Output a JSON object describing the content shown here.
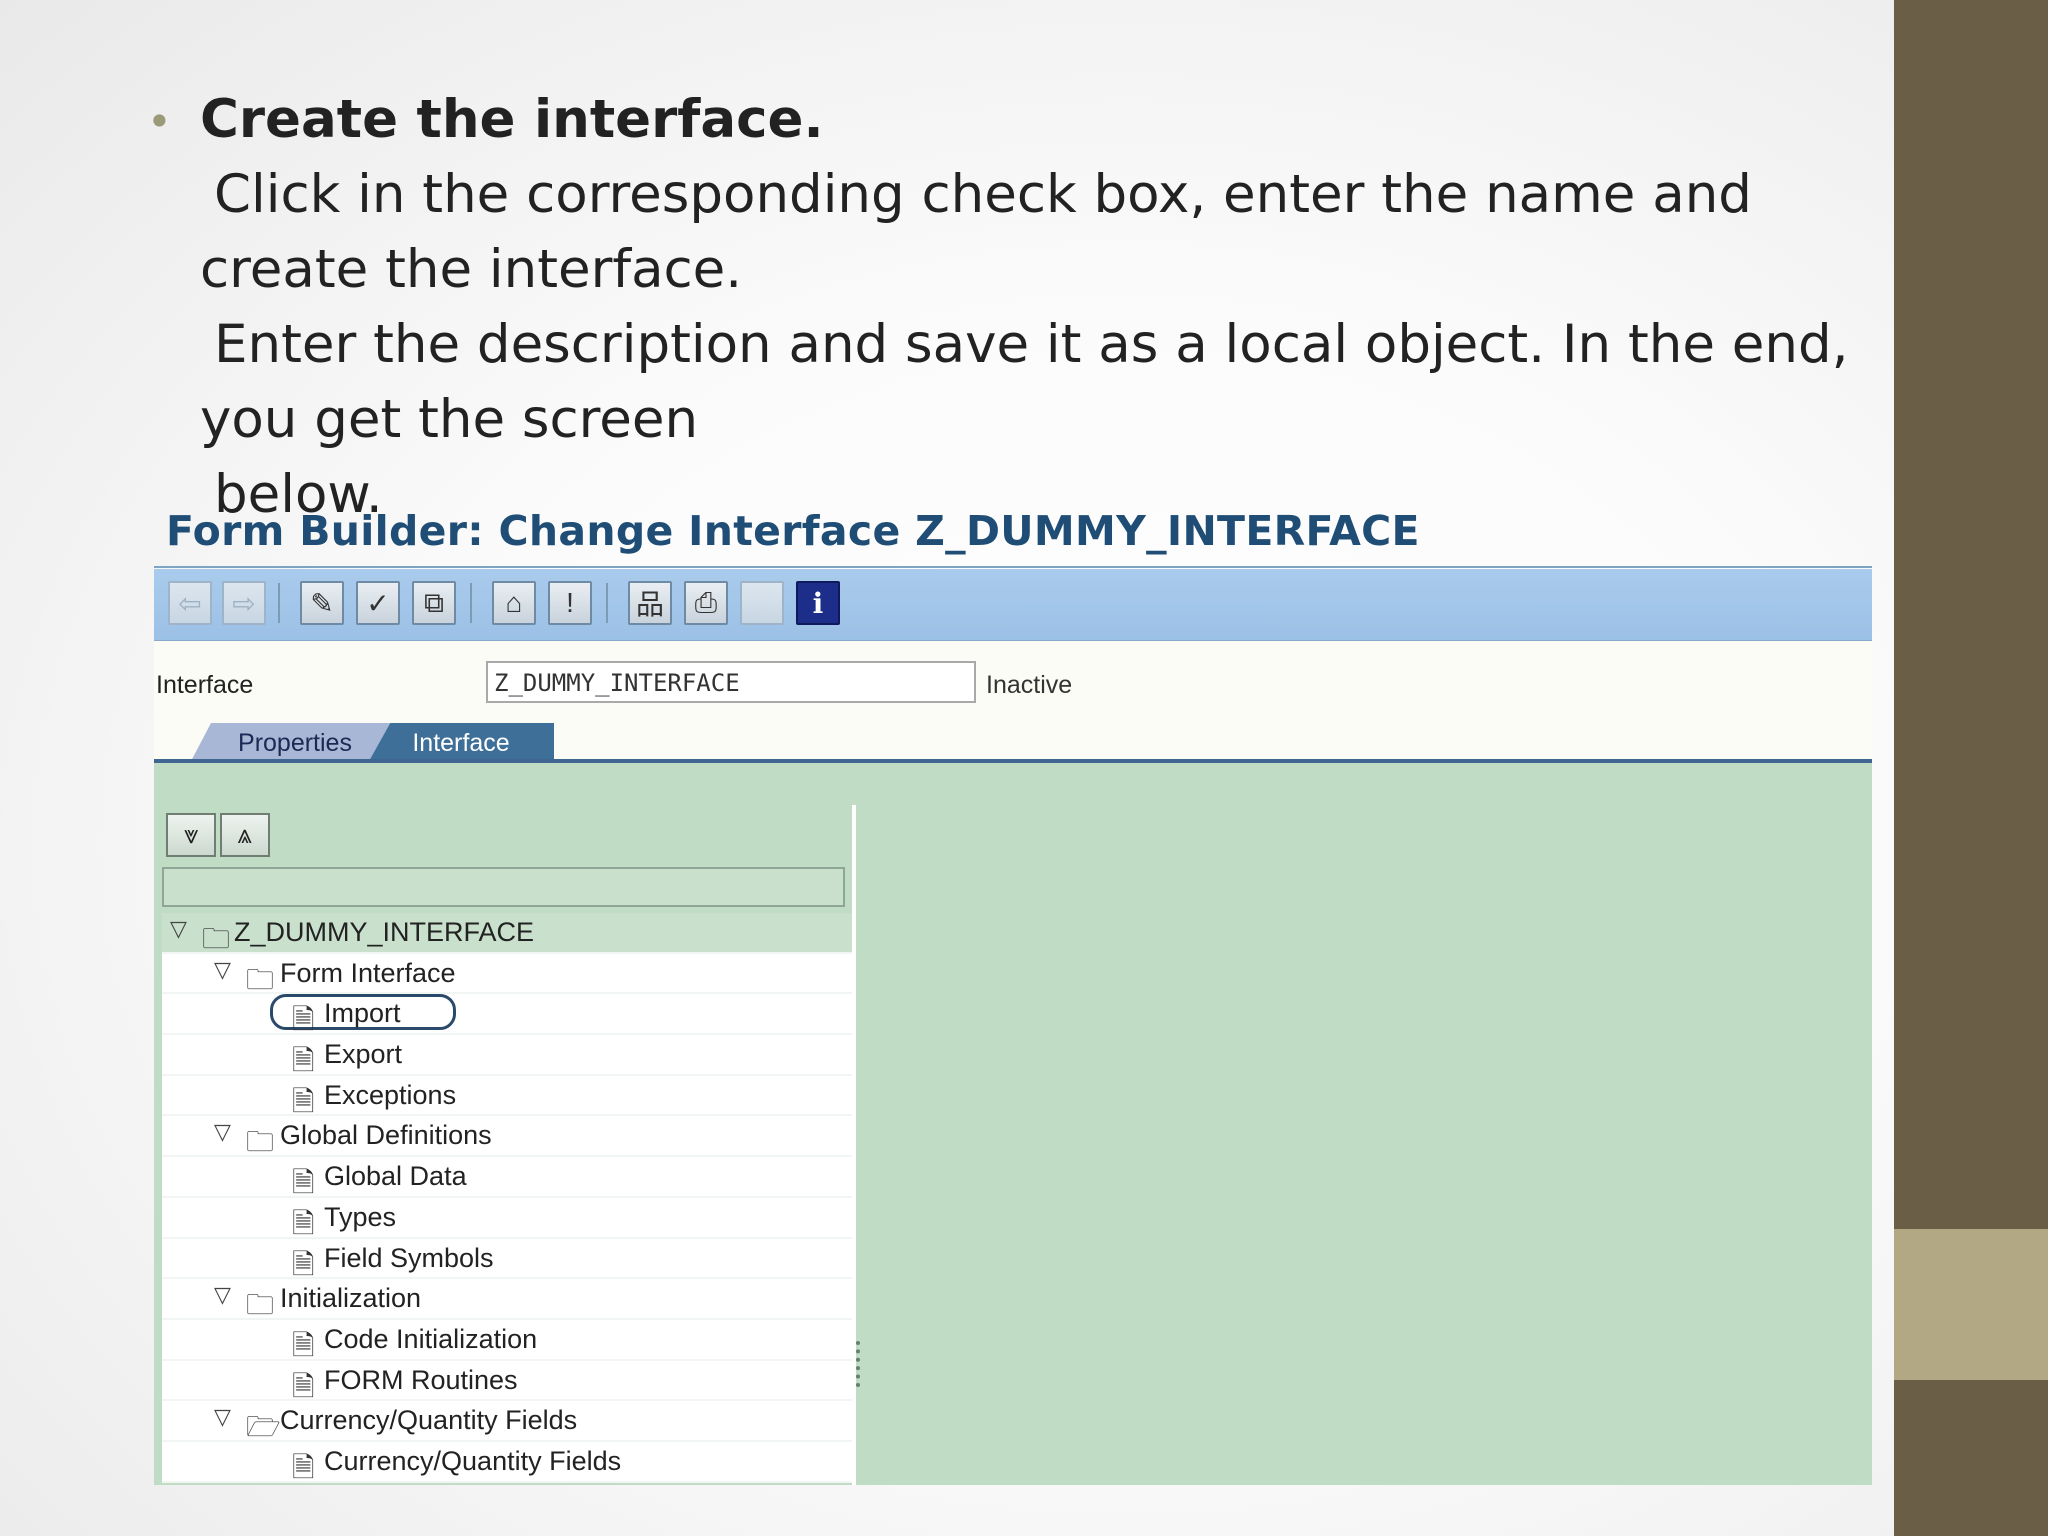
{
  "slide": {
    "bullet_title": "Create the interface.",
    "line1": "Click in the corresponding check box, enter the name and",
    "line2": "create the interface.",
    "line3": "Enter the description and save it as a local object. In the end,",
    "line4": "you get the screen",
    "line5": "below."
  },
  "sap": {
    "title": "Form Builder: Change Interface Z_DUMMY_INTERFACE",
    "toolbar": [
      {
        "name": "back-icon",
        "glyph": "⇦"
      },
      {
        "name": "forward-icon",
        "glyph": "⇨"
      },
      {
        "name": "display-change-icon",
        "glyph": "✎"
      },
      {
        "name": "check-icon",
        "glyph": "✓"
      },
      {
        "name": "activate-icon",
        "glyph": "⧉"
      },
      {
        "name": "where-used-icon",
        "glyph": "⌂"
      },
      {
        "name": "test-icon",
        "glyph": "!"
      },
      {
        "name": "hierarchy-icon",
        "glyph": "品"
      },
      {
        "name": "print-icon",
        "glyph": "⎙"
      },
      {
        "name": "blank-icon",
        "glyph": ""
      },
      {
        "name": "info-icon",
        "glyph": "i"
      }
    ],
    "form": {
      "interface_label": "Interface",
      "interface_value": "Z_DUMMY_INTERFACE",
      "status": "Inactive"
    },
    "tabs": [
      {
        "label": "Properties",
        "active": false
      },
      {
        "label": "Interface",
        "active": true
      }
    ],
    "tree_buttons": [
      {
        "name": "expand-all-icon",
        "glyph": "⩔"
      },
      {
        "name": "collapse-all-icon",
        "glyph": "⩓"
      }
    ],
    "tree": [
      {
        "label": "Z_DUMMY_INTERFACE",
        "level": 0,
        "type": "folder"
      },
      {
        "label": "Form Interface",
        "level": 1,
        "type": "folder"
      },
      {
        "label": "Import",
        "level": 2,
        "type": "doc",
        "highlighted": true
      },
      {
        "label": "Export",
        "level": 2,
        "type": "doc"
      },
      {
        "label": "Exceptions",
        "level": 2,
        "type": "doc"
      },
      {
        "label": "Global Definitions",
        "level": 1,
        "type": "folder"
      },
      {
        "label": "Global Data",
        "level": 2,
        "type": "doc"
      },
      {
        "label": "Types",
        "level": 2,
        "type": "doc"
      },
      {
        "label": "Field Symbols",
        "level": 2,
        "type": "doc"
      },
      {
        "label": "Initialization",
        "level": 1,
        "type": "folder"
      },
      {
        "label": "Code Initialization",
        "level": 2,
        "type": "doc"
      },
      {
        "label": "FORM Routines",
        "level": 2,
        "type": "doc"
      },
      {
        "label": "Currency/Quantity Fields",
        "level": 1,
        "type": "folder"
      },
      {
        "label": "Currency/Quantity Fields",
        "level": 2,
        "type": "doc"
      }
    ],
    "colors": {
      "title": "#1f4d75",
      "toolbar": "#a9cbec",
      "content": "#c0dcc4",
      "active_tab": "#3d6f99"
    }
  }
}
